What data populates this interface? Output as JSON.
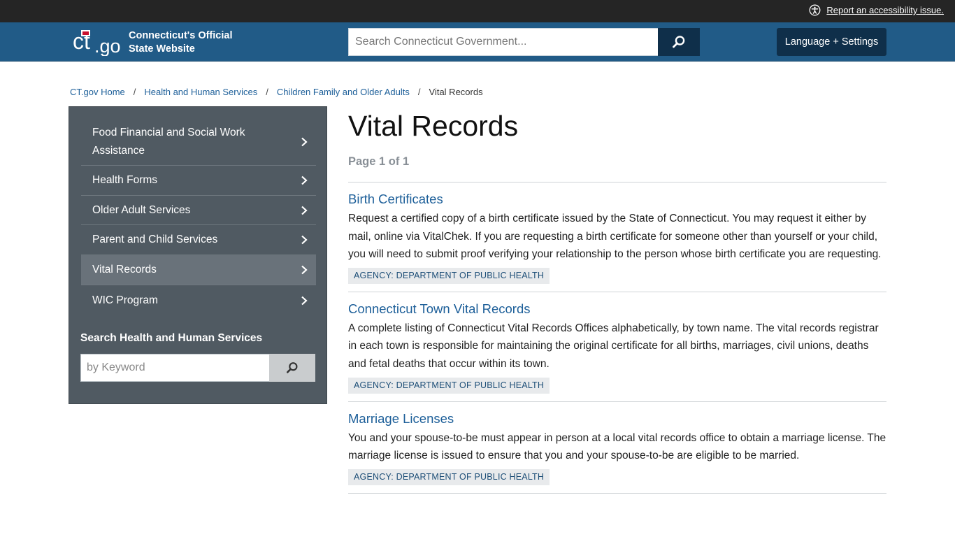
{
  "utility": {
    "accessibility_link": "Report an accessibility issue."
  },
  "header": {
    "site_title_line1": "Connecticut's Official",
    "site_title_line2": "State Website",
    "search_placeholder": "Search Connecticut Government...",
    "language_button": "Language + Settings",
    "colors": {
      "header_bg": "#215b87",
      "dark_button": "#0f2f4a"
    }
  },
  "breadcrumb": {
    "items": [
      "CT.gov Home",
      "Health and Human Services",
      "Children Family and Older Adults"
    ],
    "current": "Vital Records",
    "separator": "/"
  },
  "sidebar": {
    "items": [
      {
        "label": "Food Financial and Social Work Assistance",
        "active": false
      },
      {
        "label": "Health Forms",
        "active": false
      },
      {
        "label": "Older Adult Services",
        "active": false
      },
      {
        "label": "Parent and Child Services",
        "active": false
      },
      {
        "label": "Vital Records",
        "active": true
      },
      {
        "label": "WIC Program",
        "active": false
      }
    ],
    "search_title": "Search Health and Human Services",
    "search_placeholder": "by Keyword"
  },
  "main": {
    "title": "Vital Records",
    "page_count": "Page 1 of 1",
    "results": [
      {
        "title": "Birth Certificates",
        "description": "Request a certified copy of a birth certificate issued by the State of Connecticut. You may request it either by mail, online via VitalChek. If you are requesting a birth certificate for someone other than yourself or your child, you will need to submit proof verifying your relationship to the person whose birth certificate you are requesting.",
        "agency": "AGENCY: DEPARTMENT OF PUBLIC HEALTH"
      },
      {
        "title": "Connecticut Town Vital Records",
        "description": "A complete listing of Connecticut Vital Records Offices alphabetically, by town name. The vital records registrar in each town is responsible for maintaining the original certificate for all births, marriages, civil unions, deaths and fetal deaths that occur within its town.",
        "agency": "AGENCY: DEPARTMENT OF PUBLIC HEALTH"
      },
      {
        "title": "Marriage Licenses",
        "description": "You and your spouse-to-be must appear in person at a local vital records office to obtain a marriage license. The marriage license is issued to ensure that you and your spouse-to-be are eligible to be married.",
        "agency": "AGENCY: DEPARTMENT OF PUBLIC HEALTH"
      }
    ]
  }
}
